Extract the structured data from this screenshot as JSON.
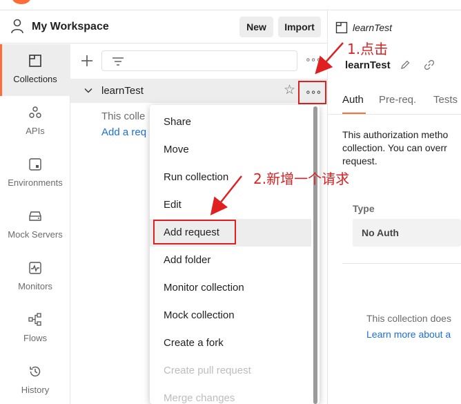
{
  "workspace": {
    "title": "My Workspace",
    "new_label": "New",
    "import_label": "Import"
  },
  "rail": {
    "items": [
      {
        "label": "Collections",
        "icon": "collections-icon",
        "active": true
      },
      {
        "label": "APIs",
        "icon": "apis-icon"
      },
      {
        "label": "Environments",
        "icon": "environments-icon"
      },
      {
        "label": "Mock Servers",
        "icon": "mock-servers-icon"
      },
      {
        "label": "Monitors",
        "icon": "monitors-icon"
      },
      {
        "label": "Flows",
        "icon": "flows-icon"
      },
      {
        "label": "History",
        "icon": "history-icon"
      }
    ]
  },
  "collections": {
    "more_top": "∘∘∘",
    "items": [
      {
        "name": "learnTest",
        "more": "∘∘∘"
      }
    ],
    "empty_text": "This colle",
    "empty_link": "Add a req"
  },
  "menu": {
    "items": [
      {
        "label": "Share"
      },
      {
        "label": "Move"
      },
      {
        "label": "Run collection"
      },
      {
        "label": "Edit"
      },
      {
        "label": "Add request",
        "highlighted": true
      },
      {
        "label": "Add folder"
      },
      {
        "label": "Monitor collection"
      },
      {
        "label": "Mock collection"
      },
      {
        "label": "Create a fork"
      },
      {
        "label": "Create pull request",
        "disabled": true
      },
      {
        "label": "Merge changes",
        "disabled": true
      }
    ]
  },
  "right": {
    "crumb": "learnTest",
    "title": "learnTest",
    "tabs": [
      "Auth",
      "Pre-req.",
      "Tests"
    ],
    "auth_desc_lines": [
      "This authorization metho",
      "collection. You can overr",
      "request."
    ],
    "type_label": "Type",
    "type_value": "No Auth",
    "note_text": "This collection does",
    "note_link": "Learn more about a"
  },
  "annotations": {
    "step1": "1.点击",
    "step2": "2.新增一个请求"
  },
  "colors": {
    "accent": "#ff6c37",
    "annotation": "#e02020",
    "link": "#1a6fdb"
  }
}
